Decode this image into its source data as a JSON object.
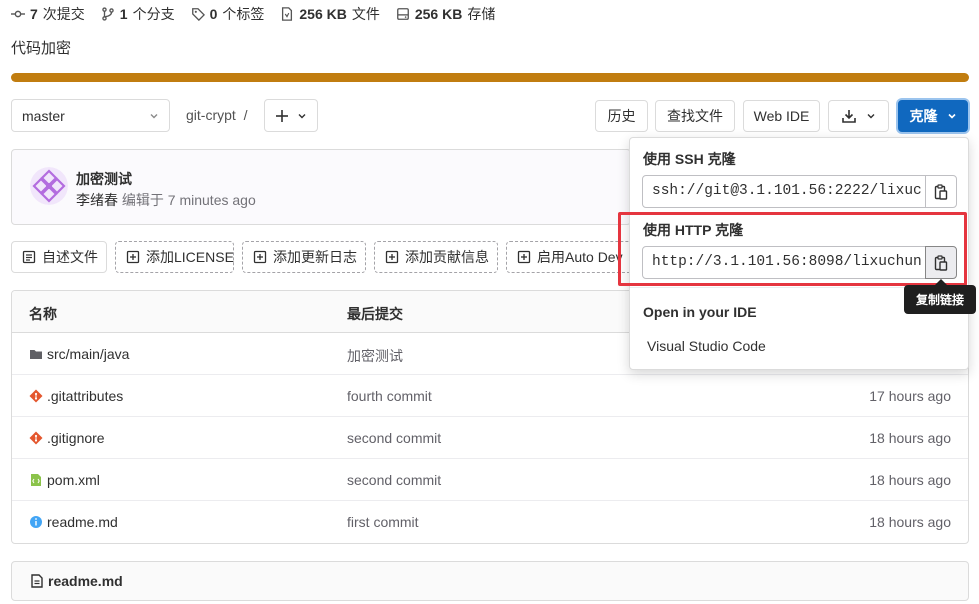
{
  "stats": [
    {
      "value": "7",
      "label": "次提交",
      "icon": "commit-icon"
    },
    {
      "value": "1",
      "label": "个分支",
      "icon": "branch-icon"
    },
    {
      "value": "0",
      "label": "个标签",
      "icon": "tag-icon"
    },
    {
      "value": "256 KB",
      "label": "文件",
      "icon": "file-icon"
    },
    {
      "value": "256 KB",
      "label": "存储",
      "icon": "storage-icon"
    }
  ],
  "description": "代码加密",
  "toolbar": {
    "branch": "master",
    "path": "git-crypt",
    "path_sep": "/",
    "history": "历史",
    "find_file": "查找文件",
    "web_ide": "Web IDE",
    "clone": "克隆"
  },
  "commit": {
    "title": "加密测试",
    "author": "李绪春",
    "edited": "编辑于",
    "time": "7 minutes ago"
  },
  "shortcuts": [
    "自述文件",
    "添加LICENSE",
    "添加更新日志",
    "添加贡献信息",
    "启用Auto Dev"
  ],
  "table": {
    "headers": {
      "name": "名称",
      "last_commit": "最后提交"
    },
    "rows": [
      {
        "name": "src/main/java",
        "commit": "加密测试",
        "time": "",
        "icon": "folder-icon"
      },
      {
        "name": ".gitattributes",
        "commit": "fourth commit",
        "time": "17 hours ago",
        "icon": "git-file-icon"
      },
      {
        "name": ".gitignore",
        "commit": "second commit",
        "time": "18 hours ago",
        "icon": "git-file-icon"
      },
      {
        "name": "pom.xml",
        "commit": "second commit",
        "time": "18 hours ago",
        "icon": "xml-file-icon"
      },
      {
        "name": "readme.md",
        "commit": "first commit",
        "time": "18 hours ago",
        "icon": "info-icon"
      }
    ]
  },
  "readme": {
    "label": "readme.md"
  },
  "clone_dropdown": {
    "ssh_label": "使用 SSH 克隆",
    "ssh_url": "ssh://git@3.1.101.56:2222/lixuc",
    "http_label": "使用 HTTP 克隆",
    "http_url": "http://3.1.101.56:8098/lixuchun",
    "ide_label": "Open in your IDE",
    "ide_option": "Visual Studio Code"
  },
  "tooltip": "复制链接",
  "colors": {
    "progress": "#c17d10",
    "primary": "#1068bf",
    "highlight": "#e5353f"
  }
}
